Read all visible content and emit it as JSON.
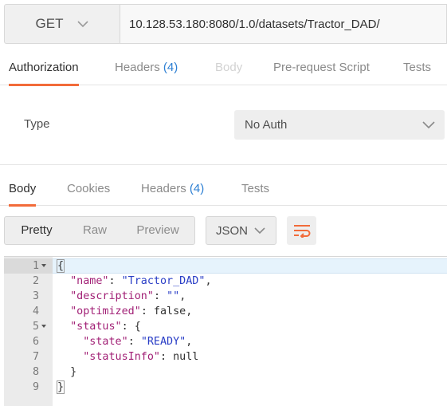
{
  "request": {
    "method": "GET",
    "url": "10.128.53.180:8080/1.0/datasets/Tractor_DAD/"
  },
  "request_tabs": [
    {
      "label": "Authorization",
      "state": "active"
    },
    {
      "label": "Headers",
      "count": "(4)",
      "state": "normal"
    },
    {
      "label": "Body",
      "state": "disabled"
    },
    {
      "label": "Pre-request Script",
      "state": "normal"
    },
    {
      "label": "Tests",
      "state": "normal"
    }
  ],
  "auth": {
    "type_label": "Type",
    "type_value": "No Auth"
  },
  "response_tabs": [
    {
      "label": "Body",
      "state": "active"
    },
    {
      "label": "Cookies",
      "state": "normal"
    },
    {
      "label": "Headers",
      "count": "(4)",
      "state": "normal"
    },
    {
      "label": "Tests",
      "state": "normal"
    }
  ],
  "response_toolbar": {
    "formats": [
      "Pretty",
      "Raw",
      "Preview"
    ],
    "active_format": "Pretty",
    "language": "JSON"
  },
  "response_body": {
    "lines": [
      {
        "n": "1",
        "text": "{",
        "fold": true
      },
      {
        "n": "2",
        "text": "  \"name\": \"Tractor_DAD\","
      },
      {
        "n": "3",
        "text": "  \"description\": \"\","
      },
      {
        "n": "4",
        "text": "  \"optimized\": false,"
      },
      {
        "n": "5",
        "text": "  \"status\": {",
        "fold": true
      },
      {
        "n": "6",
        "text": "    \"state\": \"READY\","
      },
      {
        "n": "7",
        "text": "    \"statusInfo\": null"
      },
      {
        "n": "8",
        "text": "  }"
      },
      {
        "n": "9",
        "text": "}"
      }
    ]
  },
  "colors": {
    "accent": "#f26b3a",
    "count": "#2d7fd3",
    "json_key": "#a11f75",
    "json_string": "#2a3ec6"
  }
}
